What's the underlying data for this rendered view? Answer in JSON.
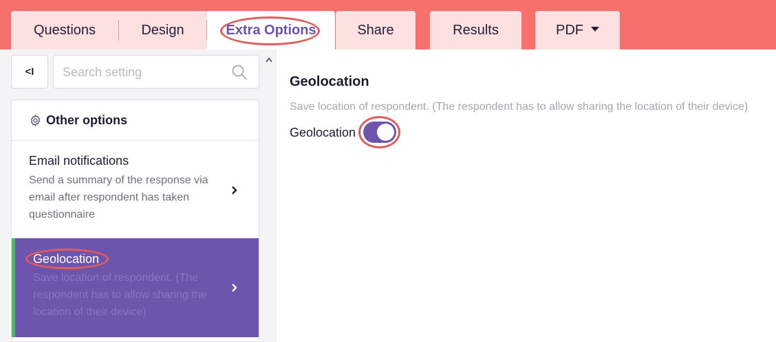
{
  "tabs": {
    "questions": "Questions",
    "design": "Design",
    "extra_options": "Extra Options",
    "share": "Share",
    "results": "Results",
    "pdf": "PDF"
  },
  "sidebar": {
    "collapse_label": "<I",
    "search_placeholder": "Search setting",
    "section_title": "Other options",
    "items": [
      {
        "title": "Email notifications",
        "description": "Send a summary of the response via email after respondent has taken questionnaire",
        "selected": false
      },
      {
        "title": "Geolocation",
        "description": "Save location of respondent. (The respondent has to allow sharing the location of their device)",
        "selected": true
      }
    ]
  },
  "main": {
    "title": "Geolocation",
    "description": "Save location of respondent. (The respondent has to allow sharing the location of their device)",
    "toggle_label": "Geolocation",
    "toggle_on": true
  },
  "colors": {
    "topbar": "#f8706b",
    "tab_bg": "#fde0e0",
    "accent": "#6d55ad",
    "selected_marker": "#4cb863",
    "highlight": "#e25b5b"
  }
}
